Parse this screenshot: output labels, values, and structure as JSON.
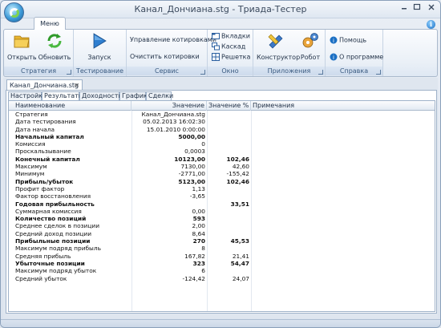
{
  "window": {
    "title": "Канал_Дончиана.stg - Триада-Тестер"
  },
  "ribbon": {
    "tab_label": "Меню",
    "groups": {
      "strategy": {
        "label": "Стратегия",
        "open_label": "Открыть",
        "refresh_label": "Обновить"
      },
      "testing": {
        "label": "Тестирование",
        "run_label": "Запуск"
      },
      "service": {
        "label": "Сервис",
        "manage_quotes_label": "Управление котировками",
        "clear_quotes_label": "Очистить котировки"
      },
      "window": {
        "label": "Окно",
        "tabs_label": "Вкладки",
        "cascade_label": "Каскад",
        "grid_label": "Решетка"
      },
      "apps": {
        "label": "Приложения",
        "constructor_label": "Конструктор",
        "robot_label": "Робот"
      },
      "help": {
        "label": "Справка",
        "help_label": "Помощь",
        "about_label": "О программе"
      }
    }
  },
  "document": {
    "tab_label": "Канал_Дончиана.stg",
    "close_glyph": "✕",
    "subtabs": [
      "Настройки",
      "Результаты",
      "Доходность",
      "График",
      "Сделки"
    ],
    "active_subtab": "Результаты",
    "columns": [
      "Наименование",
      "Значение",
      "Значение %",
      "Примечания"
    ],
    "rows": [
      {
        "name": "Стратегия",
        "value": "Канал_Дончиана.stg",
        "pct": "",
        "bold": false
      },
      {
        "name": "Дата тестирования",
        "value": "05.02.2013 16:02:30",
        "pct": "",
        "bold": false
      },
      {
        "name": "Дата начала",
        "value": "15.01.2010 0:00:00",
        "pct": "",
        "bold": false
      },
      {
        "name": "Начальный капитал",
        "value": "5000,00",
        "pct": "",
        "bold": true
      },
      {
        "name": "Комиссия",
        "value": "0",
        "pct": "",
        "bold": false
      },
      {
        "name": "Проскальзывание",
        "value": "0,0003",
        "pct": "",
        "bold": false
      },
      {
        "name": "Конечный капитал",
        "value": "10123,00",
        "pct": "102,46",
        "bold": true
      },
      {
        "name": "Максимум",
        "value": "7130,00",
        "pct": "42,60",
        "bold": false
      },
      {
        "name": "Минимум",
        "value": "-2771,00",
        "pct": "-155,42",
        "bold": false
      },
      {
        "name": "Прибыль/убыток",
        "value": "5123,00",
        "pct": "102,46",
        "bold": true
      },
      {
        "name": "Профит фактор",
        "value": "1,13",
        "pct": "",
        "bold": false
      },
      {
        "name": "Фактор восстановления",
        "value": "-3,65",
        "pct": "",
        "bold": false
      },
      {
        "name": "Годовая прибыльность",
        "value": "",
        "pct": "33,51",
        "bold": true
      },
      {
        "name": "Суммарная комиссия",
        "value": "0,00",
        "pct": "",
        "bold": false
      },
      {
        "name": "Количество позиций",
        "value": "593",
        "pct": "",
        "bold": true
      },
      {
        "name": "Среднее сделок в позиции",
        "value": "2,00",
        "pct": "",
        "bold": false
      },
      {
        "name": "Средний доход позиции",
        "value": "8,64",
        "pct": "",
        "bold": false
      },
      {
        "name": "Прибыльные позиции",
        "value": "270",
        "pct": "45,53",
        "bold": true
      },
      {
        "name": "Максимум подряд прибыль",
        "value": "8",
        "pct": "",
        "bold": false
      },
      {
        "name": "Средняя прибыль",
        "value": "167,82",
        "pct": "21,41",
        "bold": false
      },
      {
        "name": "Убыточные позиции",
        "value": "323",
        "pct": "54,47",
        "bold": true
      },
      {
        "name": "Максимум подряд убыток",
        "value": "6",
        "pct": "",
        "bold": false
      },
      {
        "name": "Средний убыток",
        "value": "-124,42",
        "pct": "24,07",
        "bold": false
      }
    ]
  },
  "icons": {
    "app": "app-orb-icon",
    "open": "folder-icon",
    "refresh": "refresh-icon",
    "run": "play-icon",
    "tabs": "tabs-icon",
    "cascade": "cascade-icon",
    "grid": "grid-icon",
    "constructor": "constructor-icon",
    "robot": "robot-gears-icon",
    "help": "help-icon",
    "about": "info-icon"
  },
  "colors": {
    "accent": "#1a6fc4",
    "ribbon_label": "#3a5a80"
  }
}
